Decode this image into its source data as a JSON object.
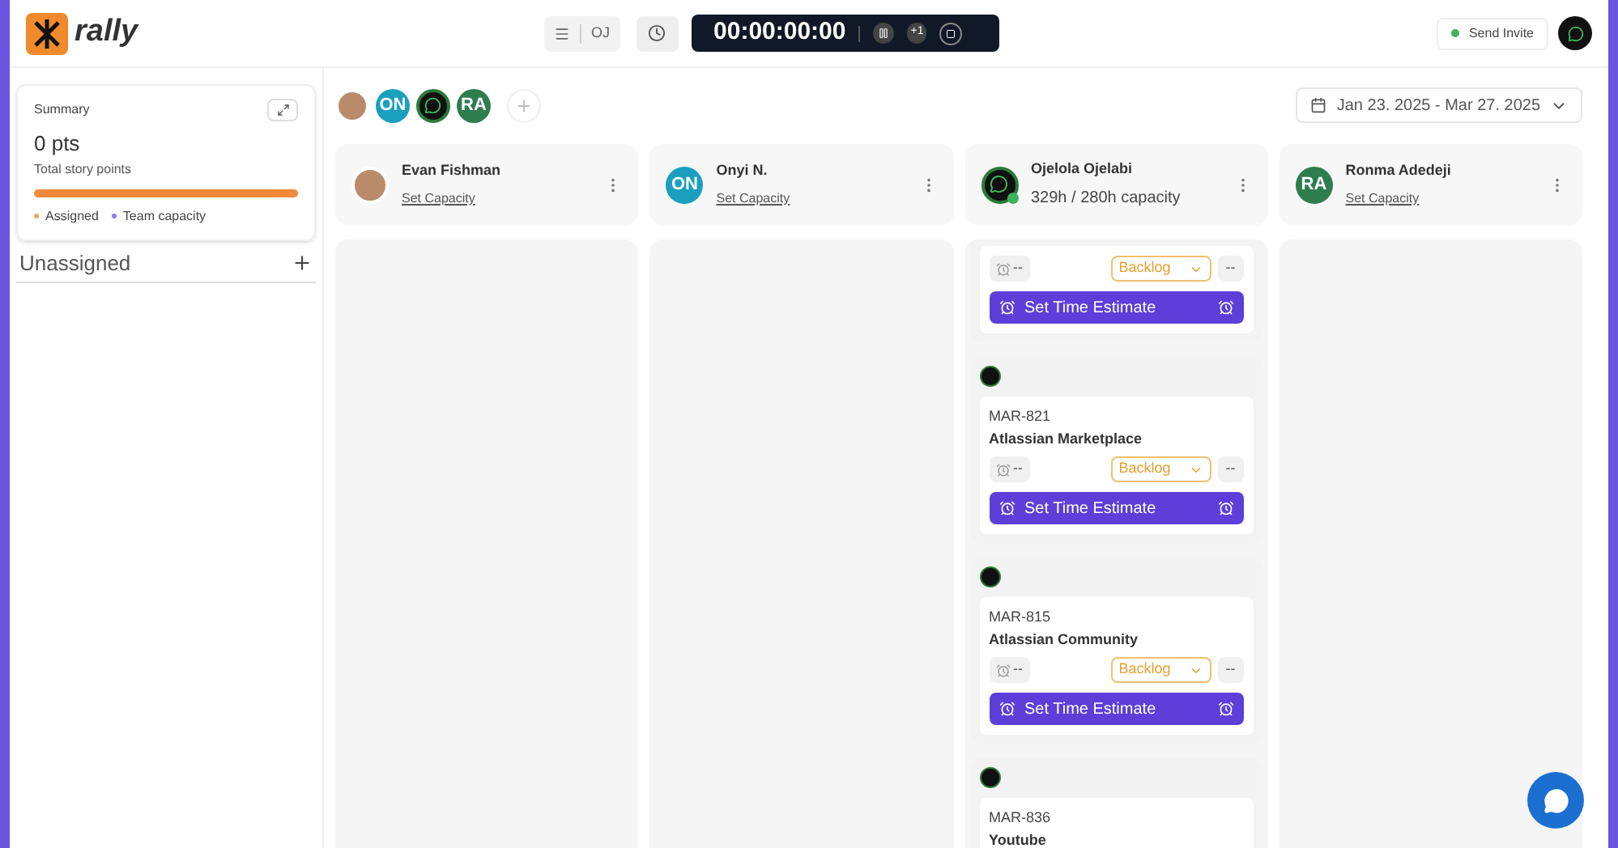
{
  "header": {
    "logo": "rally",
    "view_toggle": "OJ",
    "timer": "00:00:00:00",
    "timer_extra": "+1",
    "send_invite": "Send Invite"
  },
  "summary": {
    "title": "Summary",
    "points": "0 pts",
    "subtitle": "Total story points",
    "level": 1,
    "legend": [
      {
        "label": "Assigned",
        "color": "#f0a860"
      },
      {
        "label": "Team capacity",
        "color": "#8b7cf0"
      }
    ]
  },
  "unassigned": {
    "label": "Unassigned"
  },
  "members": [
    {
      "kind": "photo"
    },
    {
      "kind": "initials",
      "initials": "ON",
      "color": "#1a9fbf"
    },
    {
      "kind": "logo"
    },
    {
      "kind": "initials",
      "initials": "RA",
      "color": "#2e7d4f"
    }
  ],
  "date_range": "Jan 23. 2025 - Mar 27. 2025",
  "columns": [
    {
      "name": "Evan Fishman",
      "avatar": {
        "kind": "photo"
      },
      "online": false,
      "capacity": {
        "kind": "link",
        "text": "Set Capacity"
      }
    },
    {
      "name": "Onyi N.",
      "avatar": {
        "kind": "initials",
        "initials": "ON",
        "color": "#1a9fbf"
      },
      "online": false,
      "capacity": {
        "kind": "link",
        "text": "Set Capacity"
      }
    },
    {
      "name": "Ojelola Ojelabi",
      "avatar": {
        "kind": "logo"
      },
      "online": true,
      "capacity": {
        "kind": "text",
        "text": "329h / 280h capacity"
      },
      "cards": [
        {
          "kind": "cut_top",
          "estimate": "--",
          "status": "Backlog",
          "points": "--",
          "action": "Set Time Estimate"
        },
        {
          "kind": "full",
          "id": "MAR-821",
          "title": "Atlassian Marketplace",
          "estimate": "--",
          "status": "Backlog",
          "points": "--",
          "action": "Set Time Estimate"
        },
        {
          "kind": "full",
          "id": "MAR-815",
          "title": "Atlassian Community",
          "estimate": "--",
          "status": "Backlog",
          "points": "--",
          "action": "Set Time Estimate"
        },
        {
          "kind": "cut_bottom",
          "id": "MAR-836",
          "title": "Youtube"
        }
      ]
    },
    {
      "name": "Ronma Adedeji",
      "avatar": {
        "kind": "initials",
        "initials": "RA",
        "color": "#2e7d4f"
      },
      "online": false,
      "capacity": {
        "kind": "link",
        "text": "Set Capacity"
      }
    }
  ]
}
